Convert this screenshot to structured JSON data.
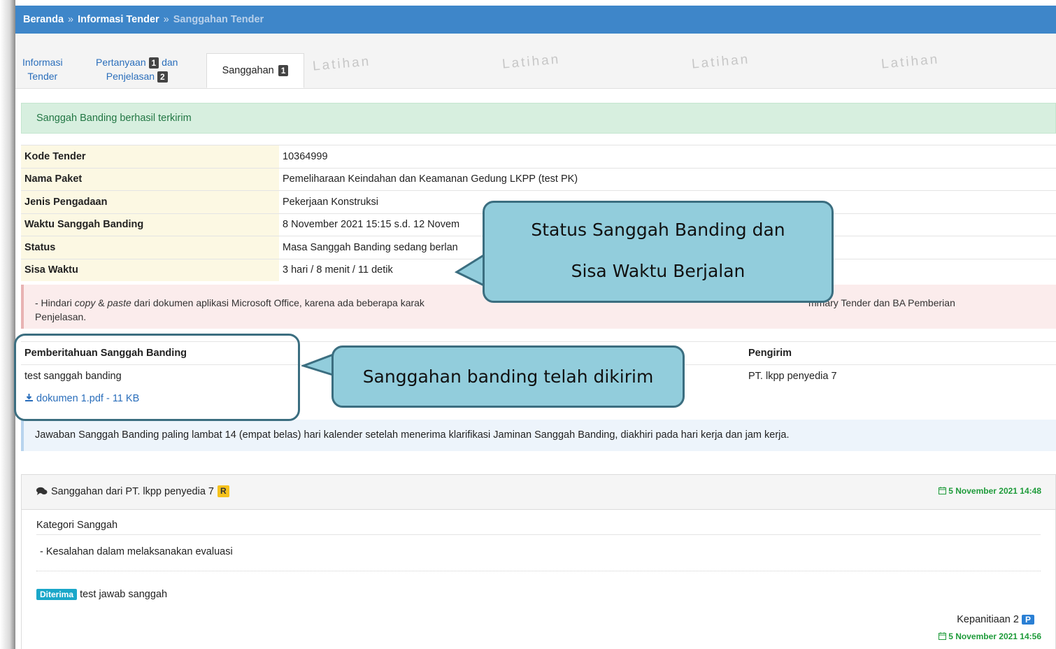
{
  "breadcrumb": {
    "home": "Beranda",
    "separator": "»",
    "tender_info": "Informasi Tender",
    "current": "Sanggahan Tender"
  },
  "tabs": {
    "info_line1": "Informasi",
    "info_line2": "Tender",
    "qa_line1": "Pertanyaan",
    "qa_badge1": "1",
    "qa_and": "dan",
    "qa_line2": "Penjelasan",
    "qa_badge2": "2",
    "active_label": "Sanggahan",
    "active_badge": "1"
  },
  "watermark": "Latihan",
  "success_message": "Sanggah Banding berhasil terkirim",
  "info_table": [
    {
      "key": "Kode Tender",
      "value": "10364999"
    },
    {
      "key": "Nama Paket",
      "value": "Pemeliharaan Keindahan dan Keamanan Gedung LKPP (test PK)"
    },
    {
      "key": "Jenis Pengadaan",
      "value": "Pekerjaan Konstruksi"
    },
    {
      "key": "Waktu Sanggah Banding",
      "value": "8 November 2021 15:15 s.d. 12 Novem"
    },
    {
      "key": "Status",
      "value": "Masa Sanggah Banding sedang berlan"
    },
    {
      "key": "Sisa Waktu",
      "value": "3 hari / 8 menit / 11 detik"
    }
  ],
  "warning": {
    "prefix": "- Hindari ",
    "copy": "copy",
    "amp": " & ",
    "paste": "paste",
    "before_callout": " dari dokumen aplikasi Microsoft Office, karena ada beberapa karak",
    "after_callout": "mmary Tender dan BA Pemberian",
    "line2": "Penjelasan."
  },
  "notification": {
    "header_left": "Pemberitahuan Sanggah Banding",
    "header_right": "Pengirim",
    "text": "test sanggah banding",
    "sender": "PT. lkpp penyedia 7",
    "file": "dokumen 1.pdf - 11 KB"
  },
  "info_notice": "Jawaban Sanggah Banding paling lambat 14 (empat belas) hari kalender setelah menerima klarifikasi Jaminan Sanggah Banding, diakhiri pada hari kerja dan jam kerja.",
  "panel": {
    "title": "Sanggahan dari PT. lkpp penyedia 7",
    "badge": "R",
    "date": "5 November 2021 14:48",
    "kategori_label": "Kategori Sanggah",
    "kategori_item": "-  Kesalahan dalam melaksanakan evaluasi",
    "status_label": "Diterima",
    "answer": "test jawab sanggah",
    "responder": "Kepanitiaan 2",
    "responder_badge": "P",
    "answer_date": "5 November 2021 14:56"
  },
  "callouts": {
    "status_line1": "Status Sanggah Banding dan",
    "status_line2": "Sisa Waktu Berjalan",
    "sent": "Sanggahan banding telah dikirim"
  },
  "colors": {
    "breadcrumb_bg": "#3e86c9",
    "callout_fill": "#92cddc",
    "callout_border": "#3b6e80",
    "success_bg": "#d7efdf"
  }
}
